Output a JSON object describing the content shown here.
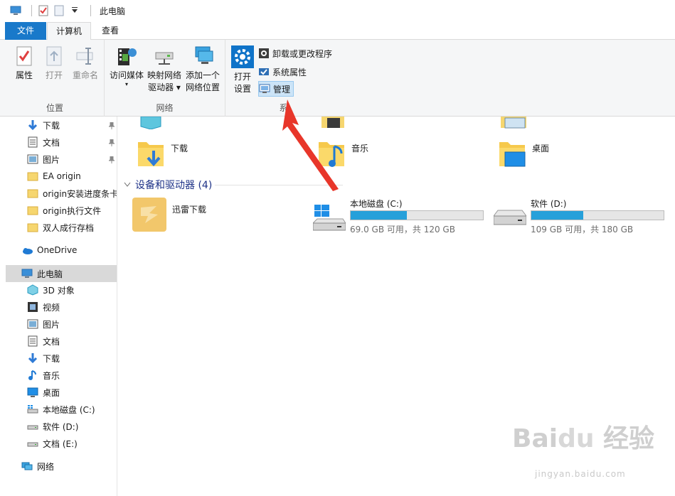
{
  "window": {
    "title": "此电脑"
  },
  "tabs": [
    {
      "label": "文件"
    },
    {
      "label": "计算机"
    },
    {
      "label": "查看"
    }
  ],
  "ribbon": {
    "location": {
      "label": "位置",
      "properties": "属性",
      "open": "打开",
      "rename": "重命名"
    },
    "network": {
      "label": "网络",
      "access_media": "访问媒体",
      "map_drive_line1": "映射网络",
      "map_drive_line2": "驱动器",
      "add_location_line1": "添加一个",
      "add_location_line2": "网络位置"
    },
    "system": {
      "label_visible": "系",
      "open_settings_line1": "打开",
      "open_settings_line2": "设置",
      "uninstall": "卸载或更改程序",
      "sys_props": "系统属性",
      "manage": "管理"
    }
  },
  "nav": {
    "items": [
      {
        "label": "下载",
        "icon": "download-arrow-icon",
        "pinned": true
      },
      {
        "label": "文档",
        "icon": "document-icon",
        "pinned": true
      },
      {
        "label": "图片",
        "icon": "picture-icon",
        "pinned": true
      },
      {
        "label": "EA origin",
        "icon": "folder-icon",
        "pinned": false
      },
      {
        "label": "origin安装进度条卡",
        "icon": "folder-icon",
        "pinned": false
      },
      {
        "label": "origin执行文件",
        "icon": "folder-icon",
        "pinned": false
      },
      {
        "label": "双人成行存档",
        "icon": "folder-icon",
        "pinned": false
      },
      {
        "label": "OneDrive",
        "icon": "cloud-icon",
        "pinned": false
      },
      {
        "label": "此电脑",
        "icon": "computer-icon",
        "pinned": false
      },
      {
        "label": "3D 对象",
        "icon": "cube-icon",
        "pinned": false
      },
      {
        "label": "视频",
        "icon": "film-icon",
        "pinned": false
      },
      {
        "label": "图片",
        "icon": "picture-icon",
        "pinned": false
      },
      {
        "label": "文档",
        "icon": "document-icon",
        "pinned": false
      },
      {
        "label": "下载",
        "icon": "download-arrow-icon",
        "pinned": false
      },
      {
        "label": "音乐",
        "icon": "music-note-icon",
        "pinned": false
      },
      {
        "label": "桌面",
        "icon": "desktop-icon",
        "pinned": false
      },
      {
        "label": "本地磁盘 (C:)",
        "icon": "drive-icon",
        "pinned": false
      },
      {
        "label": "软件 (D:)",
        "icon": "drive-icon",
        "pinned": false
      },
      {
        "label": "文档 (E:)",
        "icon": "drive-icon",
        "pinned": false
      },
      {
        "label": "网络",
        "icon": "network-icon",
        "pinned": false
      }
    ]
  },
  "folders": [
    {
      "label": "下载",
      "icon": "download-folder-icon"
    },
    {
      "label": "音乐",
      "icon": "music-folder-icon"
    },
    {
      "label": "桌面",
      "icon": "desktop-folder-icon"
    }
  ],
  "devices_section": {
    "title": "设备和驱动器 (4)"
  },
  "devices": {
    "xunlei": {
      "label": "迅雷下载"
    },
    "c": {
      "name": "本地磁盘 (C:)",
      "info": "69.0 GB 可用，共 120 GB",
      "used_fraction": 0.425
    },
    "d": {
      "name": "软件 (D:)",
      "info": "109 GB 可用，共 180 GB",
      "used_fraction": 0.394
    }
  },
  "colors": {
    "accent": "#1979ca",
    "drive_bar": "#26a0da",
    "arrow": "#e8362a",
    "selected_nav": "#d9d9d9"
  }
}
